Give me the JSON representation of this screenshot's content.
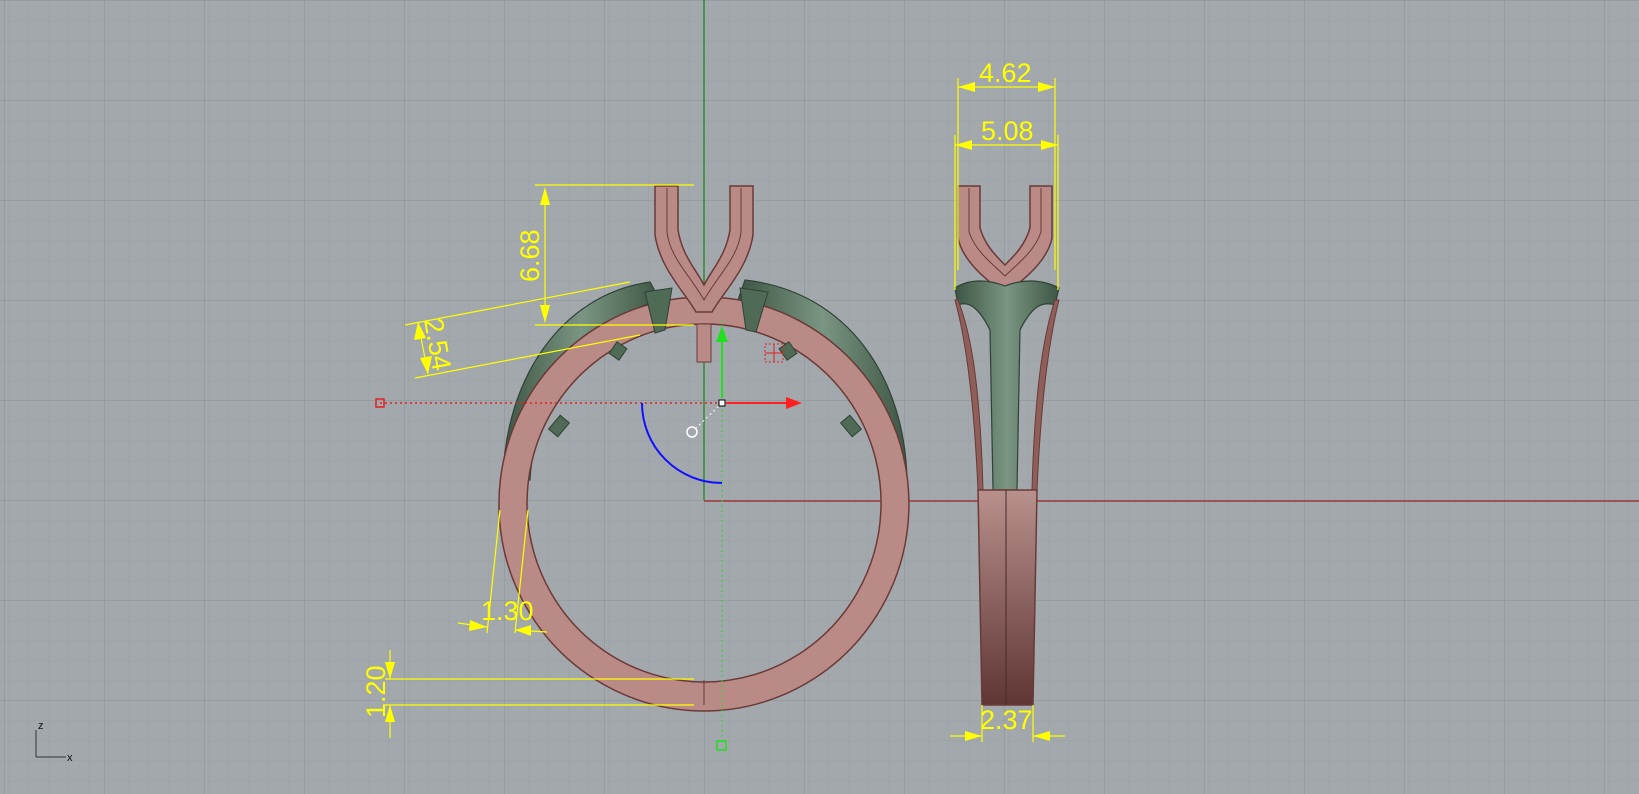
{
  "viewport": {
    "colors": {
      "background": "#a3a8ad",
      "grid_minor": "#9aa0a6",
      "grid_major": "#8a9096",
      "x_axis": "#a03a3a",
      "y_axis": "#2e8b2e",
      "dimension": "#ffff00",
      "ring_metal": "#b98a86",
      "ring_edge": "#6b3a36",
      "setting_green": "#4f6b55",
      "gumball_x": "#ff2020",
      "gumball_y": "#20e020",
      "gumball_rotate": "#1010ff"
    },
    "axis_indicator": {
      "z_label": "z",
      "x_label": "x"
    },
    "dimensions": {
      "prong_height": "6.68",
      "seat_depth": "2.54",
      "band_width_side": "1.30",
      "band_thickness_bottom": "1.20",
      "top_inner_width": "4.62",
      "top_outer_width": "5.08",
      "shank_width": "2.37"
    }
  }
}
